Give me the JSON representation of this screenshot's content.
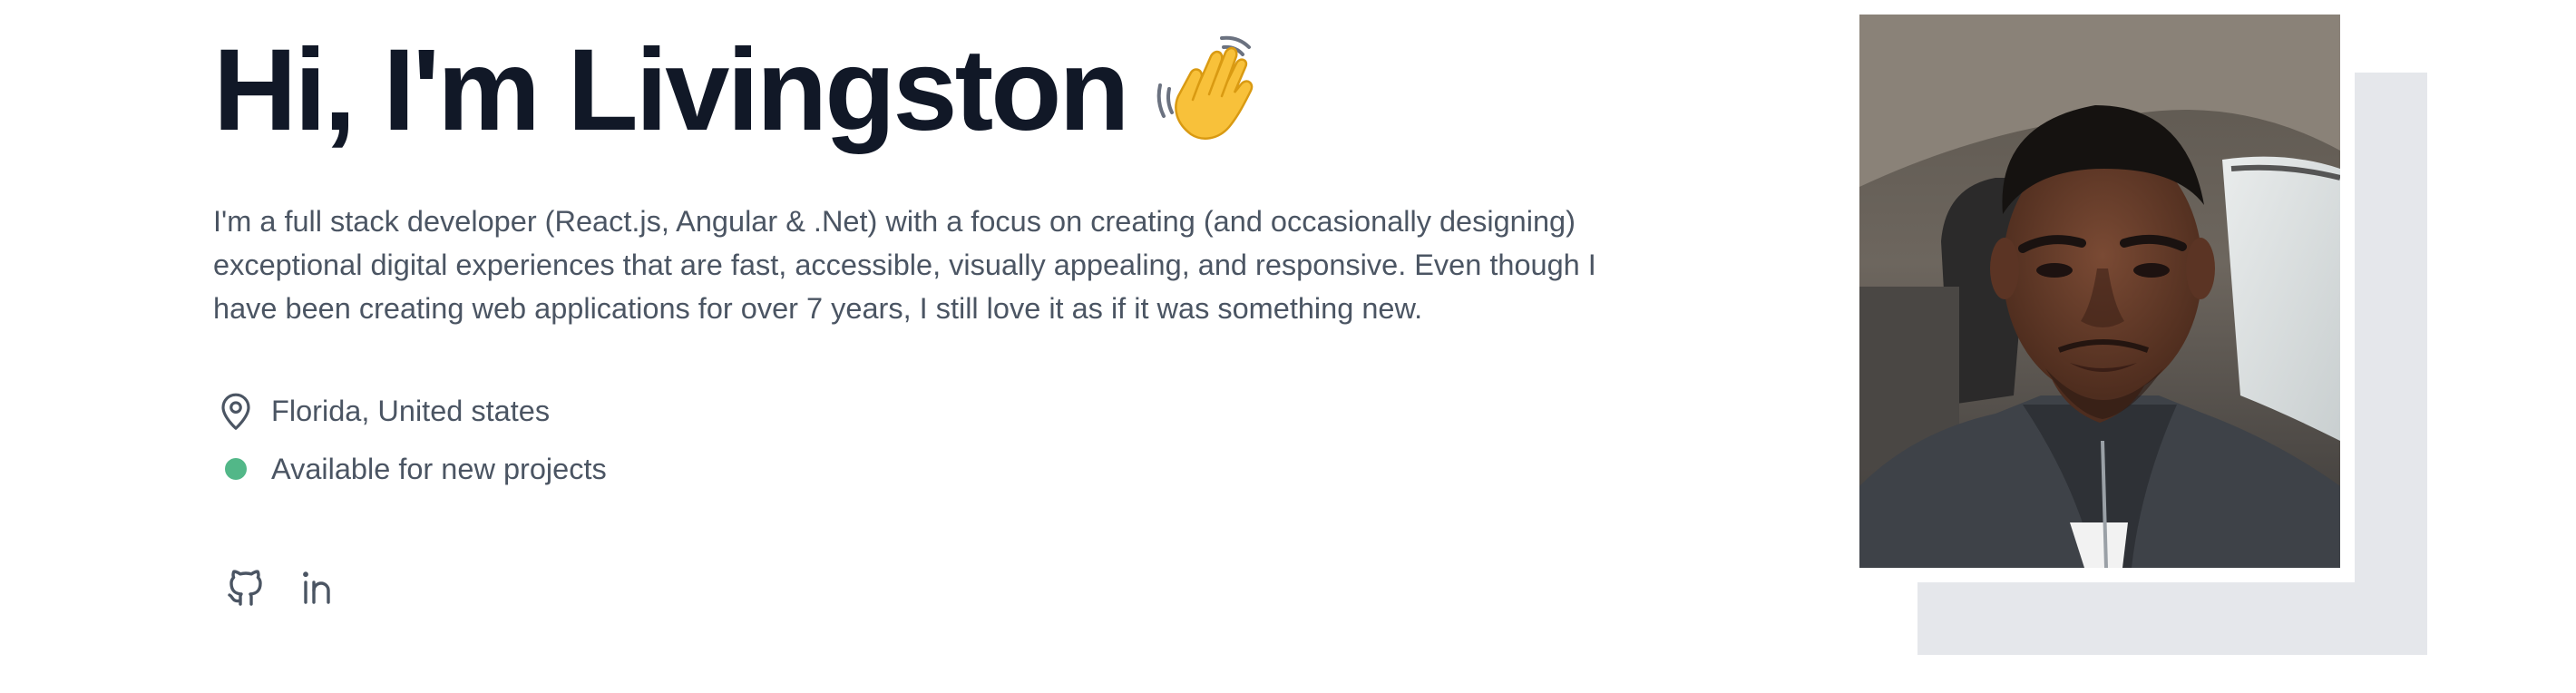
{
  "hero": {
    "greeting": "Hi, I'm Livingston",
    "wave_icon": "waving-hand-emoji",
    "intro": "I'm a full stack developer (React.js, Angular & .Net) with a focus on creating (and occasionally designing) exceptional digital experiences that are fast, accessible, visually appealing, and responsive. Even though I have been creating web applications for over 7 years, I still love it as if it was something new.",
    "location": "Florida, United states",
    "availability": "Available for new projects",
    "status_color": "#52b788",
    "socials": [
      {
        "icon": "github-icon"
      },
      {
        "icon": "linkedin-icon"
      }
    ],
    "photo_alt": "Portrait of Livingston"
  }
}
